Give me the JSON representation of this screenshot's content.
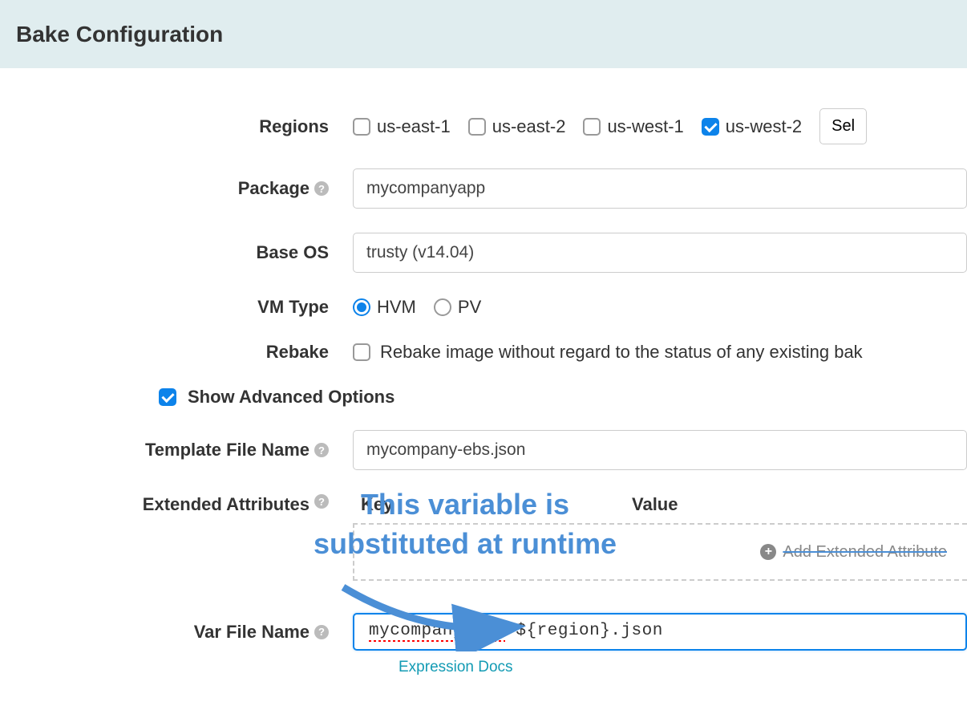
{
  "header": {
    "title": "Bake Configuration"
  },
  "form": {
    "regions": {
      "label": "Regions",
      "items": [
        {
          "label": "us-east-1",
          "checked": false
        },
        {
          "label": "us-east-2",
          "checked": false
        },
        {
          "label": "us-west-1",
          "checked": false
        },
        {
          "label": "us-west-2",
          "checked": true
        }
      ],
      "select_btn": "Sel"
    },
    "package": {
      "label": "Package",
      "value": "mycompanyapp"
    },
    "base_os": {
      "label": "Base OS",
      "value": "trusty (v14.04)"
    },
    "vm_type": {
      "label": "VM Type",
      "options": [
        {
          "label": "HVM",
          "selected": true
        },
        {
          "label": "PV",
          "selected": false
        }
      ]
    },
    "rebake": {
      "label": "Rebake",
      "description": "Rebake image without regard to the status of any existing bak",
      "checked": false
    },
    "advanced": {
      "label": "Show Advanced Options",
      "checked": true
    },
    "template_file": {
      "label": "Template File Name",
      "value": "mycompany-ebs.json"
    },
    "extended_attributes": {
      "label": "Extended Attributes",
      "key_header": "Key",
      "value_header": "Value",
      "add_label": "Add Extended Attribute"
    },
    "var_file": {
      "label": "Var File Name",
      "value_part1": "mycompany-var",
      "value_part2": "-${region}.json",
      "value_full": "mycompany-var-${region}.json",
      "docs_link": "Expression Docs"
    }
  },
  "annotation": {
    "line1": "This variable is",
    "line2": "substituted at runtime"
  },
  "colors": {
    "primary": "#0d83ea",
    "teal": "#139bb4",
    "annotation": "#4b8fd6"
  }
}
